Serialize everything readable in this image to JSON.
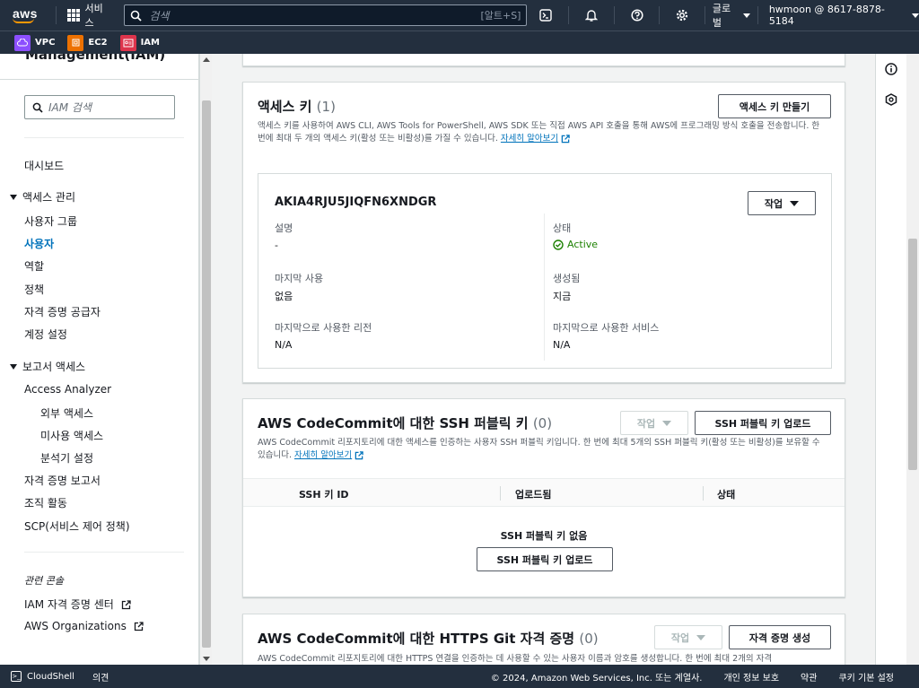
{
  "topnav": {
    "logo": "aws",
    "services_label": "서비스",
    "search_placeholder": "검색",
    "search_shortcut": "[알트+S]",
    "region": "글로벌",
    "account": "hwmoon @ 8617-8878-5184"
  },
  "service_shortcuts": [
    {
      "label": "VPC",
      "color": "#8c4fff"
    },
    {
      "label": "EC2",
      "color": "#ed7100"
    },
    {
      "label": "IAM",
      "color": "#dd344c"
    }
  ],
  "sidebar": {
    "title": "Management(IAM)",
    "search_placeholder": "IAM 검색",
    "dashboard": "대시보드",
    "access_mgmt": "액세스 관리",
    "access_items": [
      "사용자 그룹",
      "사용자",
      "역할",
      "정책",
      "자격 증명 공급자",
      "계정 설정"
    ],
    "active_item": "사용자",
    "reports": "보고서 액세스",
    "access_analyzer": "Access Analyzer",
    "analyzer_items": [
      "외부 액세스",
      "미사용 액세스",
      "분석기 설정"
    ],
    "report_items": [
      "자격 증명 보고서",
      "조직 활동",
      "SCP(서비스 제어 정책)"
    ],
    "related_label": "관련 콘솔",
    "related_links": [
      "IAM 자격 증명 센터",
      "AWS Organizations"
    ]
  },
  "access_keys": {
    "title": "액세스 키",
    "count": "(1)",
    "create_button": "액세스 키 만들기",
    "description": "액세스 키를 사용하여 AWS CLI, AWS Tools for PowerShell, AWS SDK 또는 직접 AWS API 호출을 통해 AWS에 프로그래밍 방식 호출을 전송합니다. 한 번에 최대 두 개의 액세스 키(활성 또는 비활성)를 가질 수 있습니다.",
    "learn_more": "자세히 알아보기",
    "key": {
      "id": "AKIA4RJU5JIQFN6XNDGR",
      "actions_button": "작업",
      "desc_label": "설명",
      "desc_value": "-",
      "status_label": "상태",
      "status_value": "Active",
      "last_used_label": "마지막 사용",
      "last_used_value": "없음",
      "created_label": "생성됨",
      "created_value": "지금",
      "last_region_label": "마지막으로 사용한 리전",
      "last_region_value": "N/A",
      "last_service_label": "마지막으로 사용한 서비스",
      "last_service_value": "N/A"
    }
  },
  "ssh_keys": {
    "title": "AWS CodeCommit에 대한 SSH 퍼블릭 키",
    "count": "(0)",
    "actions_button": "작업",
    "upload_button": "SSH 퍼블릭 키 업로드",
    "description": "AWS CodeCommit 리포지토리에 대한 액세스를 인증하는 사용자 SSH 퍼블릭 키입니다. 한 번에 최대 5개의 SSH 퍼블릭 키(활성 또는 비활성)를 보유할 수 있습니다.",
    "learn_more": "자세히 알아보기",
    "columns": [
      "SSH 키 ID",
      "업로드됨",
      "상태"
    ],
    "empty_text": "SSH 퍼블릭 키 없음",
    "empty_button": "SSH 퍼블릭 키 업로드"
  },
  "https_git": {
    "title": "AWS CodeCommit에 대한 HTTPS Git 자격 증명",
    "count": "(0)",
    "actions_button": "작업",
    "generate_button": "자격 증명 생성",
    "description": "AWS CodeCommit 리포지토리에 대한 HTTPS 연결을 인증하는 데 사용할 수 있는 사용자 이름과 암호를 생성합니다. 한 번에 최대 2개의 자격"
  },
  "footer": {
    "cloudshell": "CloudShell",
    "feedback": "의견",
    "copyright": "© 2024, Amazon Web Services, Inc. 또는 계열사.",
    "privacy": "개인 정보 보호",
    "terms": "약관",
    "cookies": "쿠키 기본 설정"
  }
}
